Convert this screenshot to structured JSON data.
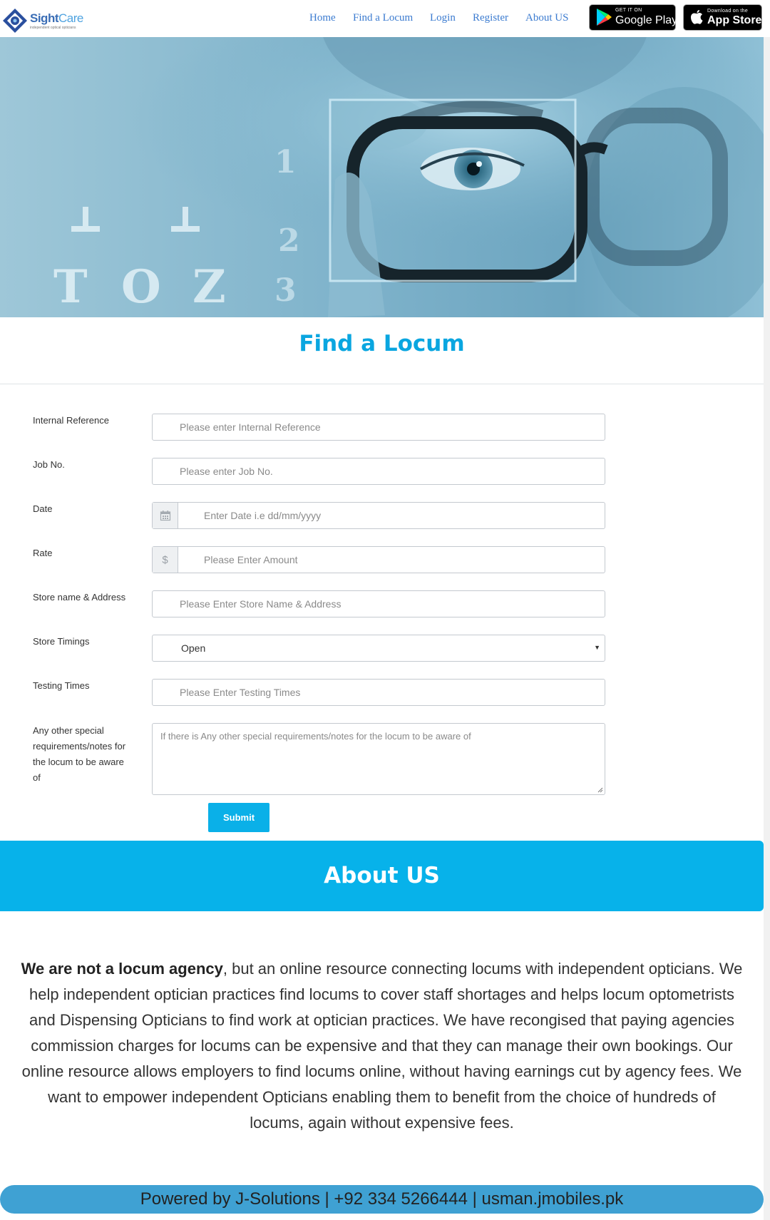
{
  "brand": {
    "name_part1": "Sight",
    "name_part2": "Care",
    "tagline": "independent optical opticians"
  },
  "nav": {
    "links": [
      "Home",
      "Find a Locum",
      "Login",
      "Register",
      "About US"
    ],
    "google_play": {
      "small": "GET IT ON",
      "big": "Google Play"
    },
    "app_store": {
      "small": "Download on the",
      "big": "App Store"
    }
  },
  "hero": {
    "chart_letters": [
      "T",
      "O",
      "Z"
    ],
    "chart_numbers": [
      "1",
      "2",
      "3"
    ]
  },
  "find_locum": {
    "title": "Find a Locum",
    "fields": {
      "internal_reference": {
        "label": "Internal Reference",
        "placeholder": "Please enter Internal Reference"
      },
      "job_no": {
        "label": "Job No.",
        "placeholder": "Please enter Job No."
      },
      "date": {
        "label": "Date",
        "placeholder": "Enter Date i.e dd/mm/yyyy"
      },
      "rate": {
        "label": "Rate",
        "placeholder": "Please Enter Amount",
        "addon": "$"
      },
      "store": {
        "label": "Store name & Address",
        "placeholder": "Please Enter Store Name & Address"
      },
      "timings": {
        "label": "Store Timings",
        "value": "Open"
      },
      "testing": {
        "label": "Testing Times",
        "placeholder": "Please Enter Testing Times"
      },
      "notes": {
        "label": "Any other special requirements/notes for the locum to be aware of",
        "placeholder": "If there is Any other special requirements/notes for the locum to be aware of"
      }
    },
    "submit": "Submit"
  },
  "about": {
    "title": "About US",
    "lead": "We are not a locum agency",
    "body": ", but an online resource connecting locums with independent opticians. We help independent optician practices find locums to cover staff shortages and helps locum optometrists and Dispensing Opticians to find work at optician practices. We have recongised that paying agencies commission charges for locums can be expensive and that they can manage their own bookings. Our online resource allows employers to find locums online, without having earnings cut by agency fees. We want to empower independent Opticians enabling them to benefit from the choice of hundreds of locums, again without expensive fees."
  },
  "footer": {
    "text": "Powered by J-Solutions | +92 334 5266444 | usman.jmobiles.pk"
  },
  "colors": {
    "accent": "#0aa6e0",
    "about_band": "#07b2ea",
    "footer": "#3fa1d3",
    "nav_link": "#3b7bd0"
  }
}
